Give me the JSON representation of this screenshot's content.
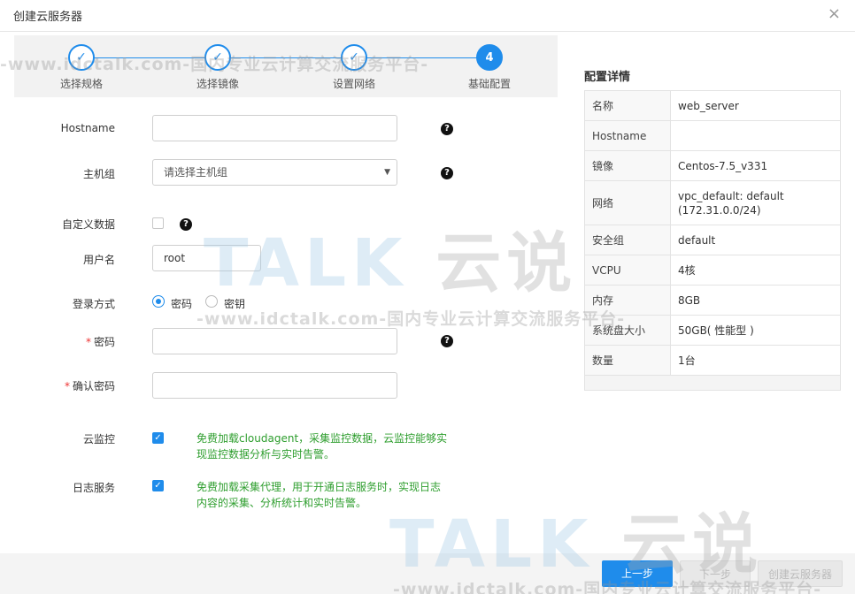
{
  "dialog": {
    "title": "创建云服务器",
    "close_icon": "×"
  },
  "steps": [
    {
      "label": "选择规格",
      "state": "done",
      "mark": "✓"
    },
    {
      "label": "选择镜像",
      "state": "done",
      "mark": "✓"
    },
    {
      "label": "设置网络",
      "state": "done",
      "mark": "✓"
    },
    {
      "label": "基础配置",
      "state": "active",
      "mark": "4"
    }
  ],
  "form": {
    "hostname": {
      "label": "Hostname",
      "value": ""
    },
    "host_group": {
      "label": "主机组",
      "placeholder": "请选择主机组"
    },
    "custom_data": {
      "label": "自定义数据",
      "checked": false
    },
    "username": {
      "label": "用户名",
      "value": "root"
    },
    "login_method": {
      "label": "登录方式",
      "options": [
        "密码",
        "密钥"
      ],
      "selected": "密码"
    },
    "password": {
      "required_mark": "*",
      "label": "密码",
      "value": ""
    },
    "confirm_password": {
      "required_mark": "*",
      "label": "确认密码",
      "value": ""
    },
    "cloud_monitor": {
      "label": "云监控",
      "checked": true,
      "description": "免费加载cloudagent，采集监控数据，云监控能够实现监控数据分析与实时告警。"
    },
    "log_service": {
      "label": "日志服务",
      "checked": true,
      "description": "免费加载采集代理，用于开通日志服务时，实现日志内容的采集、分析统计和实时告警。"
    },
    "help_icon": "?"
  },
  "details": {
    "title": "配置详情",
    "rows": [
      {
        "key": "名称",
        "value": "web_server"
      },
      {
        "key": "Hostname",
        "value": ""
      },
      {
        "key": "镜像",
        "value": "Centos-7.5_v331"
      },
      {
        "key": "网络",
        "value": "vpc_default: default (172.31.0.0/24)"
      },
      {
        "key": "安全组",
        "value": "default"
      },
      {
        "key": "VCPU",
        "value": "4核"
      },
      {
        "key": "内存",
        "value": "8GB"
      },
      {
        "key": "系统盘大小",
        "value": "50GB( 性能型 )"
      },
      {
        "key": "数量",
        "value": "1台"
      }
    ]
  },
  "footer": {
    "prev_label": "上一步",
    "next_label": "下一步",
    "create_label": "创建云服务器"
  },
  "watermark": {
    "text": "-www.idctalk.com-国内专业云计算交流服务平台-",
    "logo_latin": "TALK",
    "logo_cjk": "云说"
  },
  "colors": {
    "primary": "#1f8ceb",
    "success_text": "#2e9e2e",
    "required": "#e33333"
  }
}
